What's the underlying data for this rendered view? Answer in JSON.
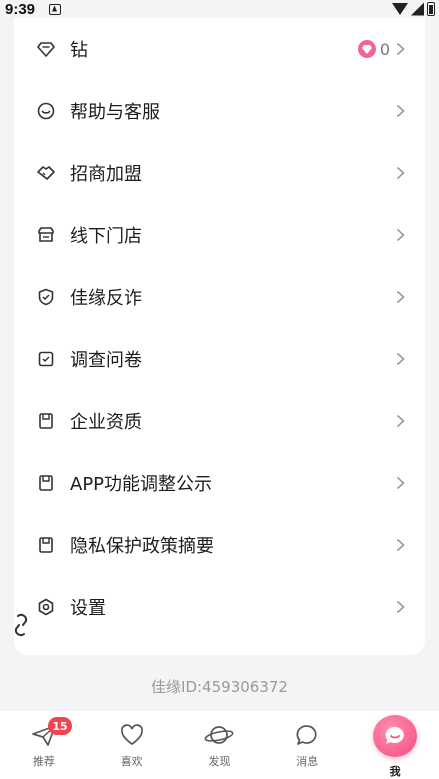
{
  "status_bar": {
    "time": "9:39"
  },
  "menu": {
    "items": [
      {
        "label": "钻",
        "icon": "diamond-icon",
        "count": "0"
      },
      {
        "label": "帮助与客服",
        "icon": "help-service-icon"
      },
      {
        "label": "招商加盟",
        "icon": "handshake-icon"
      },
      {
        "label": "线下门店",
        "icon": "store-icon"
      },
      {
        "label": "佳缘反诈",
        "icon": "shield-icon"
      },
      {
        "label": "调查问卷",
        "icon": "survey-icon"
      },
      {
        "label": "企业资质",
        "icon": "document-icon"
      },
      {
        "label": "APP功能调整公示",
        "icon": "document-icon"
      },
      {
        "label": "隐私保护政策摘要",
        "icon": "document-icon"
      },
      {
        "label": "设置",
        "icon": "gear-icon"
      }
    ]
  },
  "user_id": "佳缘ID:459306372",
  "tabbar": {
    "tabs": [
      {
        "label": "推荐",
        "badge": "15",
        "icon": "paper-plane-icon"
      },
      {
        "label": "喜欢",
        "icon": "heart-icon"
      },
      {
        "label": "发现",
        "icon": "planet-icon"
      },
      {
        "label": "消息",
        "icon": "chat-bubble-icon"
      },
      {
        "label": "我",
        "icon": "me-icon",
        "active": true
      }
    ]
  },
  "colors": {
    "accent": "#f44a7e",
    "badge": "#f2444e",
    "background": "#f4f4f6"
  }
}
